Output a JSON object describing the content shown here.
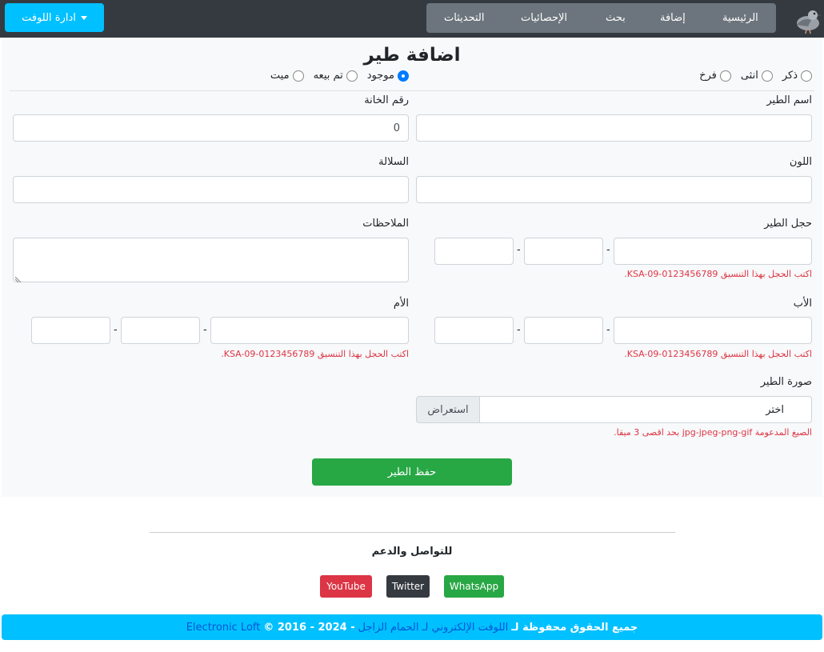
{
  "nav": {
    "links": [
      "الرئيسية",
      "إضافة",
      "بحث",
      "الإحصائيات",
      "التحديثات"
    ],
    "loft_button": "ادارة اللوفت",
    "colors": {
      "bar": "#343a40",
      "pill": "#6c757d",
      "accent": "#00c0ff"
    }
  },
  "form": {
    "title": "اضافة طير",
    "sex_options": [
      "ذكر",
      "انثى",
      "فرخ"
    ],
    "status_options": [
      "موجود",
      "تم بيعه",
      "ميت"
    ],
    "status_selected": "موجود",
    "bird_name_label": "اسم الطير",
    "box_number_label": "رقم الخانة",
    "box_number_value": "0",
    "color_label": "اللون",
    "breed_label": "السلالة",
    "ring_label": "حجل الطير",
    "notes_label": "الملاحظات",
    "ring_hint": "اكتب الحجل بهذا التنسيق KSA-09-0123456789.",
    "father_label": "الأب",
    "mother_label": "الأم",
    "photo_label": "صورة الطير",
    "choose_label": "اختر",
    "browse_label": "استعراض",
    "photo_hint": "الصيغ المدعومة jpg-jpeg-png-gif بحد اقصى 3 ميقا.",
    "save_label": "حفظ الطير"
  },
  "footer": {
    "contact": "للتواصل والدعم",
    "buttons": [
      {
        "label": "WhatsApp",
        "color": "#28a745"
      },
      {
        "label": "Twitter",
        "color": "#343a40"
      },
      {
        "label": "YouTube",
        "color": "#dc3545"
      }
    ],
    "copyright_prefix": "جميع الحقوق محفوظة لـ",
    "copyright_link": "اللوفت الإلكتروني لـ الحمام الزاجل",
    "copyright_years": "- 2024 - 2016 ©",
    "copyright_brand": "Electronic Loft"
  }
}
